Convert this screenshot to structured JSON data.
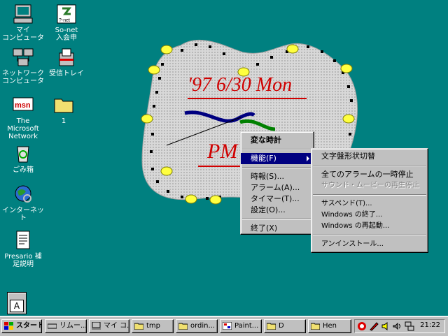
{
  "desktop": {
    "icons": [
      {
        "label": "マイ\nコンピュータ"
      },
      {
        "label": "So-net\n入会申"
      },
      {
        "label": "ネットワーク\nコンピュータ"
      },
      {
        "label": "受信トレイ"
      },
      {
        "label": "The\nMicrosoft\nNetwork"
      },
      {
        "label": "1"
      },
      {
        "label": "ごみ箱"
      },
      {
        "label": "インターネット"
      },
      {
        "label": "Presario 補\n足説明"
      }
    ],
    "sonet_logo_text": "?-net",
    "msn_logo_text": "msn",
    "tile_letter": "A"
  },
  "clock_widget": {
    "date_text": "'97 6/30 Mon",
    "ampm_text": "PM"
  },
  "context_menu": {
    "title": "変な時計",
    "items": [
      {
        "label": "機能(F)"
      },
      {
        "label": "時報(S)..."
      },
      {
        "label": "アラーム(A)..."
      },
      {
        "label": "タイマー(T)..."
      },
      {
        "label": "設定(O)..."
      },
      {
        "label": "終了(X)"
      }
    ]
  },
  "submenu": {
    "items": [
      {
        "label": "文字盤形状切替"
      },
      {
        "label": "全てのアラームの一時停止"
      },
      {
        "label": "サウンド・ムービーの再生停止"
      },
      {
        "label": "サスペンド(T)..."
      },
      {
        "label": "Windows の終了..."
      },
      {
        "label": "Windows の再起動..."
      },
      {
        "label": "アンインストール..."
      }
    ]
  },
  "taskbar": {
    "start_label": "スタート",
    "buttons": [
      {
        "label": "リムー..."
      },
      {
        "label": "マイ コ..."
      },
      {
        "label": "tmp"
      },
      {
        "label": "ordin..."
      },
      {
        "label": "Paint..."
      },
      {
        "label": "D"
      },
      {
        "label": "Hen"
      }
    ],
    "time": "21:22"
  }
}
